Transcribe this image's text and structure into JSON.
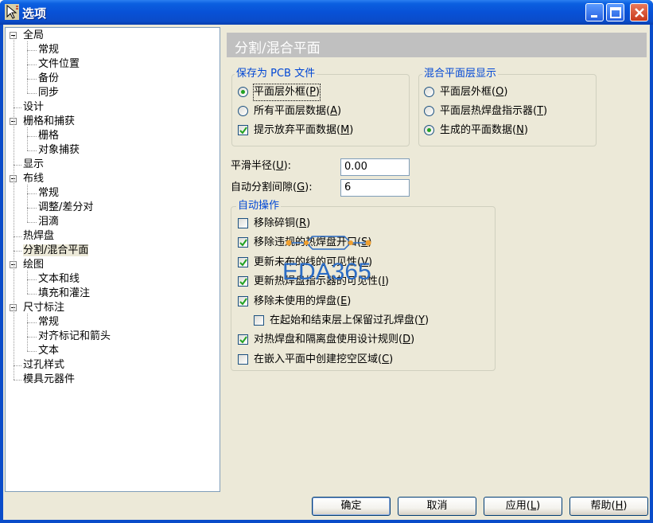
{
  "window": {
    "title": "选项"
  },
  "tree": {
    "items": [
      {
        "label": "全局",
        "level": 0,
        "expanded": true
      },
      {
        "label": "常规",
        "level": 1
      },
      {
        "label": "文件位置",
        "level": 1
      },
      {
        "label": "备份",
        "level": 1
      },
      {
        "label": "同步",
        "level": 1
      },
      {
        "label": "设计",
        "level": 0
      },
      {
        "label": "栅格和捕获",
        "level": 0,
        "expanded": true
      },
      {
        "label": "栅格",
        "level": 1
      },
      {
        "label": "对象捕获",
        "level": 1
      },
      {
        "label": "显示",
        "level": 0
      },
      {
        "label": "布线",
        "level": 0,
        "expanded": true
      },
      {
        "label": "常规",
        "level": 1
      },
      {
        "label": "调整/差分对",
        "level": 1
      },
      {
        "label": "泪滴",
        "level": 1
      },
      {
        "label": "热焊盘",
        "level": 0
      },
      {
        "label": "分割/混合平面",
        "level": 0,
        "selected": true
      },
      {
        "label": "绘图",
        "level": 0,
        "expanded": true
      },
      {
        "label": "文本和线",
        "level": 1
      },
      {
        "label": "填充和灌注",
        "level": 1
      },
      {
        "label": "尺寸标注",
        "level": 0,
        "expanded": true
      },
      {
        "label": "常规",
        "level": 1
      },
      {
        "label": "对齐标记和箭头",
        "level": 1
      },
      {
        "label": "文本",
        "level": 1
      },
      {
        "label": "过孔样式",
        "level": 0
      },
      {
        "label": "模具元器件",
        "level": 0
      }
    ]
  },
  "panel": {
    "title": "分割/混合平面",
    "save_as_pcb": {
      "title": "保存为 PCB 文件",
      "options": [
        {
          "text": "平面层外框(",
          "key": "P",
          "end": ")",
          "type": "radio",
          "checked": true,
          "focus": true
        },
        {
          "text": "所有平面层数据(",
          "key": "A",
          "end": ")",
          "type": "radio",
          "checked": false
        },
        {
          "text": "提示放弃平面数据(",
          "key": "M",
          "end": ")",
          "type": "check",
          "checked": true
        }
      ]
    },
    "mixed_display": {
      "title": "混合平面层显示",
      "options": [
        {
          "text": "平面层外框(",
          "key": "O",
          "end": ")",
          "type": "radio",
          "checked": false
        },
        {
          "text": "平面层热焊盘指示器(",
          "key": "T",
          "end": ")",
          "type": "radio",
          "checked": false
        },
        {
          "text": "生成的平面数据(",
          "key": "N",
          "end": ")",
          "type": "radio",
          "checked": true
        }
      ]
    },
    "smooth_radius": {
      "label": "平滑半径(",
      "key": "U",
      "end": "):",
      "value": "0.00"
    },
    "auto_gap": {
      "label": "自动分割间隙(",
      "key": "G",
      "end": "):",
      "value": "6"
    },
    "auto_ops": {
      "title": "自动操作",
      "options": [
        {
          "text": "移除碎铜(",
          "key": "R",
          "end": ")",
          "checked": false,
          "indent": false
        },
        {
          "text": "移除违规的热焊盘开口(",
          "key": "S",
          "end": ")",
          "checked": true,
          "indent": false
        },
        {
          "text": "更新未布的线的可见性(",
          "key": "V",
          "end": ")",
          "checked": true,
          "indent": false
        },
        {
          "text": "更新热焊盘指示器的可见性(",
          "key": "I",
          "end": ")",
          "checked": true,
          "indent": false
        },
        {
          "text": "移除未使用的焊盘(",
          "key": "E",
          "end": ")",
          "checked": true,
          "indent": false
        },
        {
          "text": "在起始和结束层上保留过孔焊盘(",
          "key": "Y",
          "end": ")",
          "checked": false,
          "indent": true
        },
        {
          "text": "对热焊盘和隔离盘使用设计规则(",
          "key": "D",
          "end": ")",
          "checked": true,
          "indent": false
        },
        {
          "text": "在嵌入平面中创建挖空区域(",
          "key": "C",
          "end": ")",
          "checked": false,
          "indent": false
        }
      ]
    }
  },
  "buttons": {
    "ok": {
      "text": "确定"
    },
    "cancel": {
      "text": "取消"
    },
    "apply": {
      "text": "应用(",
      "key": "L",
      "end": ")"
    },
    "help": {
      "text": "帮助(",
      "key": "H",
      "end": ")"
    }
  },
  "watermark": {
    "text": "EDA365"
  },
  "colors": {
    "accent": "#0046d5",
    "titlebar": "#0851d6",
    "face": "#ece9d8",
    "checkmark": "#21a121",
    "watermark": "#2b6cc4"
  },
  "icons": {
    "app": "cursor-arrow-icon",
    "minimize": "minimize-icon",
    "maximize": "maximize-icon",
    "close": "close-icon"
  }
}
